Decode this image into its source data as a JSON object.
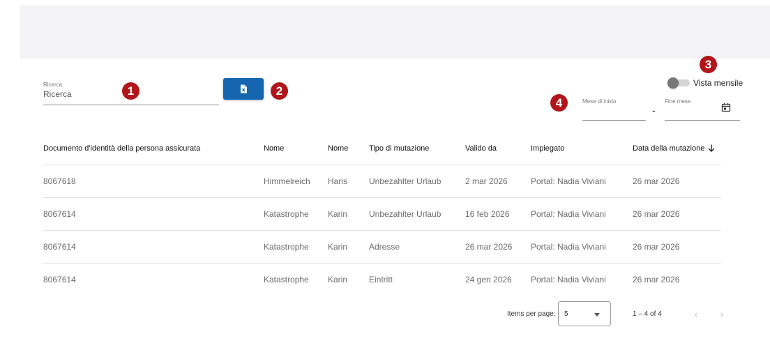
{
  "search": {
    "label": "Ricerca",
    "placeholder": "Ricerca"
  },
  "export_button": {
    "icon": "excel-icon"
  },
  "toggle": {
    "label": "Vista mensile",
    "checked": false
  },
  "date_range": {
    "start_label": "Mese di inizio",
    "separator": "-",
    "end_label": "Fine mese",
    "icon": "calendar-icon"
  },
  "markers": [
    "1",
    "2",
    "3",
    "4"
  ],
  "table": {
    "headers": [
      "Documento d'identità della persona assicurata",
      "Nome",
      "Nome",
      "Tipo di mutazione",
      "Valido da",
      "Impiegato",
      "Data della mutazione"
    ],
    "sort_icon": "arrow-down-icon",
    "rows": [
      [
        "8067618",
        "Himmelreich",
        "Hans",
        "Unbezahlter Urlaub",
        "2 mar 2026",
        "Portal: Nadia Viviani",
        "26 mar 2026"
      ],
      [
        "8067614",
        "Katastrophe",
        "Karin",
        "Unbezahlter Urlaub",
        "16 feb 2026",
        "Portal: Nadia Viviani",
        "26 mar 2026"
      ],
      [
        "8067614",
        "Katastrophe",
        "Karin",
        "Adresse",
        "26 mar 2026",
        "Portal: Nadia Viviani",
        "26 mar 2026"
      ],
      [
        "8067614",
        "Katastrophe",
        "Karin",
        "Eintritt",
        "24 gen 2026",
        "Portal: Nadia Viviani",
        "26 mar 2026"
      ]
    ]
  },
  "paginator": {
    "items_per_page_label": "Items per page:",
    "page_size": "5",
    "range_label": "1 – 4 of 4",
    "prev": "‹",
    "next": "›"
  },
  "colors": {
    "primary": "#1565b0",
    "marker": "#b0161b",
    "muted_text": "#6b6b6b"
  }
}
